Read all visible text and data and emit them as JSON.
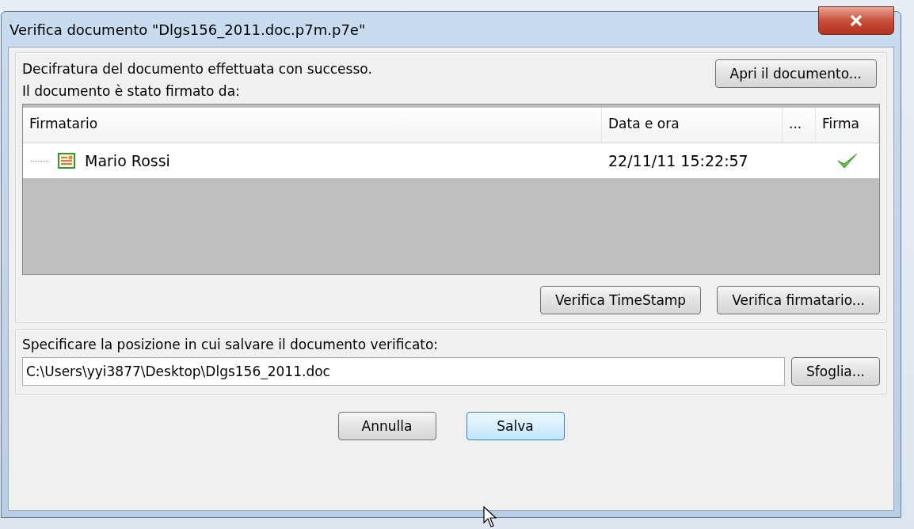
{
  "window": {
    "title": "Verifica documento \"Dlgs156_2011.doc.p7m.p7e\""
  },
  "status": {
    "message": "Decifratura del documento effettuata con successo.",
    "signed_by_label": "Il documento è stato firmato da:",
    "open_button": "Apri il documento..."
  },
  "table": {
    "columns": [
      "Firmatario",
      "Data e ora",
      "...",
      "Firma"
    ],
    "rows": [
      {
        "signer": "Mario Rossi",
        "datetime": "22/11/11 15:22:57",
        "signature_valid": true
      }
    ]
  },
  "verify_buttons": [
    "Verifica TimeStamp",
    "Verifica firmatario..."
  ],
  "save": {
    "label": "Specificare la posizione in cui salvare il documento verificato:",
    "path": "C:\\Users\\yyi3877\\Desktop\\Dlgs156_2011.doc",
    "browse_button": "Sfoglia..."
  },
  "buttons": [
    {
      "label": "Annulla",
      "hovered": false
    },
    {
      "label": "Salva",
      "hovered": true
    }
  ]
}
